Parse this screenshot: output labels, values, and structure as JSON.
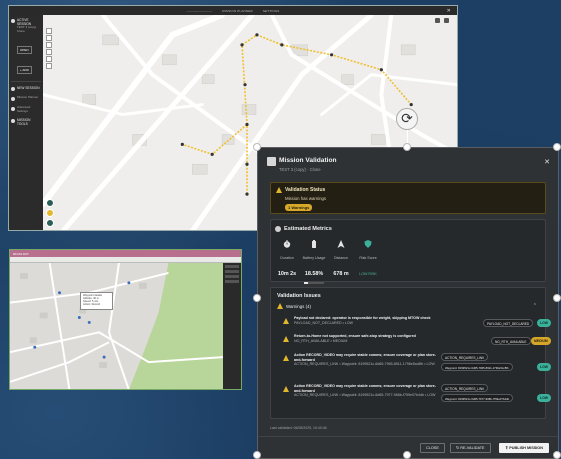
{
  "top_window": {
    "topbar_items": [
      "————————",
      "MISSION PLANNER",
      "SETTINGS"
    ],
    "sidebar": {
      "active_session_label": "ACTIVE SESSION",
      "session_name": "TEST 3 (copy) · Clone",
      "session_button": "OPEN",
      "add_label": "+ ADD",
      "section2_label": "NEW SESSION",
      "item2": "Mission Planner",
      "item3": "Advanced Settings",
      "item4": "MISSION TOOLS"
    }
  },
  "bottom_window": {
    "title": "RFA01.DAT",
    "popup_lines": [
      "Waypoint details",
      "Altitude: 40 m",
      "Speed: 5 m/s",
      "Action: Record"
    ]
  },
  "dialog": {
    "title": "Mission Validation",
    "subtitle": "TEST 3 (copy) · Clone",
    "status": {
      "title": "Validation Status",
      "message": "Mission has warnings",
      "pill": "1 Warnings"
    },
    "metrics": {
      "title": "Estimated Metrics",
      "items": [
        {
          "label": "Duration",
          "value": "10m 2s"
        },
        {
          "label": "Battery Usage",
          "value": "18.58%",
          "fraction": 0.1858
        },
        {
          "label": "Distance",
          "value": "678 m"
        },
        {
          "label": "Risk Score",
          "value": "LOW RISK"
        }
      ]
    },
    "issues": {
      "title": "Validation Issues",
      "warnings_label": "Warnings (4)",
      "items": [
        {
          "text": "Payload not declared: operator is responsible for weight, skipping MTOW check",
          "meta": "PAYLOAD_NOT_DECLARED • LOW",
          "tag": "PAYLOAD_NOT_DECLARED",
          "severity": "LOW"
        },
        {
          "text": "Return-to-Home not supported, ensure safe-stop strategy is configured",
          "meta": "NO_RTH_AVAILABLE • MEDIUM",
          "tag": "NO_RTH_AVAILABLE",
          "severity": "MEDIUM"
        },
        {
          "text": "Action RECORD_VIDEO may require stable comms; ensure coverage or plan store-and-forward",
          "meta": "ACTION_REQUIRES_LINK • Waypoint: 8199521c-6d65-7965-8911-1796e5cc8fb • LOW",
          "tag": "ACTION_REQUIRES_LINK",
          "tag2": "Waypoint: 8199521c-6d65-7965-8911-1796e5cc8fb",
          "severity": "LOW"
        },
        {
          "text": "Action RECORD_VIDEO may require stable comms; ensure coverage or plan store-and-forward",
          "meta": "ACTION_REQUIRES_LINK • Waypoint: 8199521c-6d65-7977-968b-f759e07b4db • LOW",
          "tag": "ACTION_REQUIRES_LINK",
          "tag2": "Waypoint: 8199521c-6d65-7977-968b-f759e07b4db",
          "severity": "LOW"
        }
      ]
    },
    "last_validated": "Last validated: 06/08/2025, 10:40:46",
    "buttons": {
      "close": "CLOSE",
      "revalidate": "RE-VALIDATE",
      "publish": "PUBLISH MISSION"
    }
  },
  "colors": {
    "warning": "#e0b62c",
    "low": "#3bb19b",
    "medium": "#d6a62a",
    "route": "#f0c02e"
  }
}
